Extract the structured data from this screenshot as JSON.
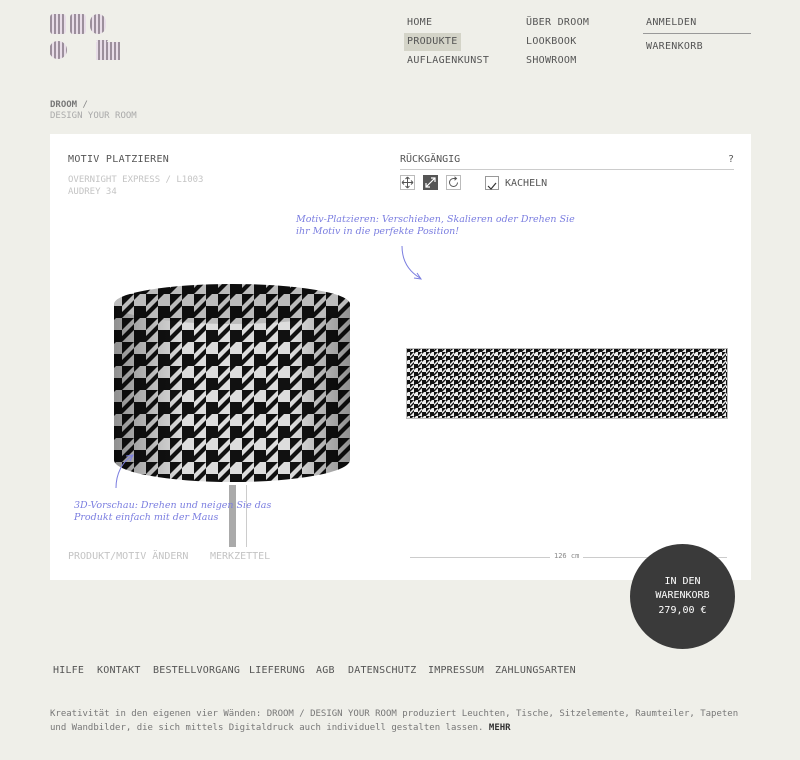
{
  "brand": {
    "logo_letters": "DROOM"
  },
  "nav": {
    "home": "HOME",
    "products": "PRODUKTE",
    "cover_art": "AUFLAGENKUNST",
    "about": "ÜBER DROOM",
    "lookbook": "LOOKBOOK",
    "showroom": "SHOWROOM",
    "login": "ANMELDEN",
    "cart": "WARENKORB"
  },
  "breadcrumb": {
    "root": "DROOM",
    "separator": " /",
    "sub": "DESIGN YOUR ROOM"
  },
  "editor": {
    "title": "MOTIV PLATZIEREN",
    "motif_line1": "OVERNIGHT EXPRESS / L1003",
    "motif_line2": "AUDREY 34",
    "undo": "RÜCKGÄNGIG",
    "help": "?",
    "tile_label": "KACHELN",
    "tile_checked": true,
    "tools": [
      "move-icon",
      "scale-icon",
      "rotate-icon"
    ],
    "hint_placement": "Motiv-Platzieren: Verschieben, Skalieren oder Drehen Sie ihr Motiv in die perfekte Position!",
    "hint_3d": "3D-Vorschau: Drehen und neigen Sie das Produkt einfach mit der Maus",
    "change_product": "PRODUKT/MOTIV ÄNDERN",
    "wishlist": "MERKZETTEL",
    "dimension": "126 cm"
  },
  "cart_button": {
    "line1": "IN DEN",
    "line2": "WARENKORB",
    "price": "279,00 €"
  },
  "footer": {
    "links": [
      "HILFE",
      "KONTAKT",
      "BESTELLVORGANG",
      "LIEFERUNG",
      "AGB",
      "DATENSCHUTZ",
      "IMPRESSUM",
      "ZAHLUNGSARTEN"
    ],
    "text": "Kreativität in den eigenen vier Wänden: DROOM / DESIGN YOUR ROOM produziert Leuchten, Tische, Sitzelemente, Raumteiler, Tapeten und Wandbilder, die sich mittels Digitaldruck auch individuell gestalten lassen.",
    "more": "MEHR"
  },
  "colors": {
    "background": "#efefe9",
    "panel": "#ffffff",
    "hint": "#7b7ee0",
    "cart": "#3a3a3a"
  }
}
